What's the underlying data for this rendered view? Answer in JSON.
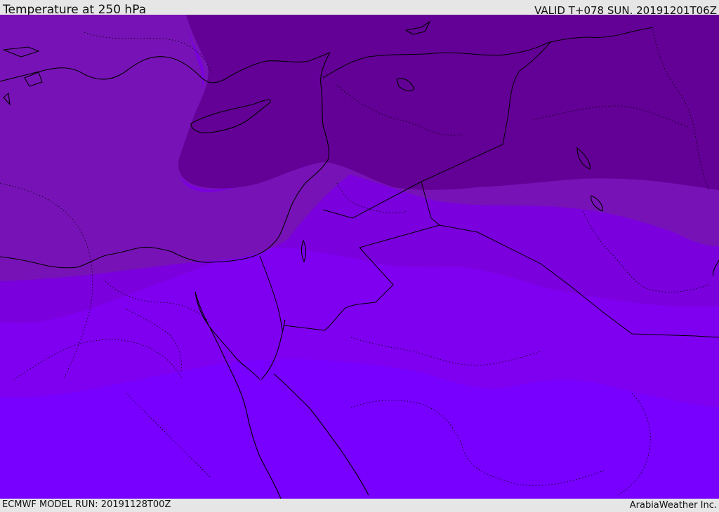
{
  "header": {
    "title": "Temperature at 250 hPa",
    "valid": "VALID T+078 SUN. 20191201T06Z"
  },
  "footer": {
    "model_run": "ECMWF MODEL RUN: 20191128T00Z",
    "credit": "ArabiaWeather Inc."
  },
  "map": {
    "field": "temperature-250hPa",
    "region": "Eastern Mediterranean / Middle East",
    "colors": {
      "band_coldest": "#630096",
      "band_cold": "#7713b6",
      "band_mid": "#7a00dd",
      "band_warm": "#7f00f0",
      "band_warmest": "#7700ff",
      "coastline": "#000000",
      "borders": "#000000"
    }
  }
}
